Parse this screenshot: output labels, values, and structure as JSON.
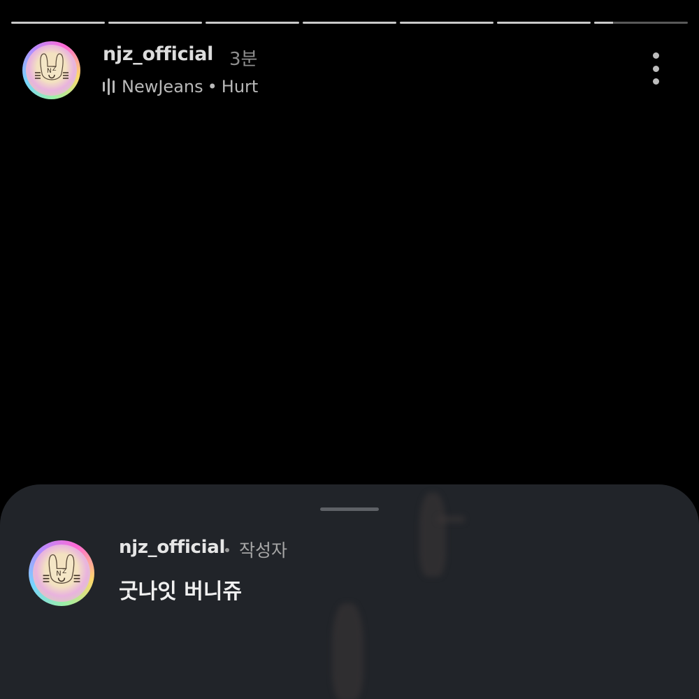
{
  "story": {
    "segments": [
      1,
      1,
      1,
      1,
      1,
      1,
      0.2
    ]
  },
  "header": {
    "username": "njz_official",
    "time_ago": "3분",
    "music": {
      "artist": "NewJeans",
      "separator": "•",
      "track": "Hurt"
    },
    "avatar_logo": "NJZ"
  },
  "comment_sheet": {
    "comment": {
      "username": "njz_official",
      "badge": "작성자",
      "text": "굿나잇 버니쥬"
    }
  },
  "icons": {
    "more": "more-vertical-icon",
    "music": "audio-bars-icon"
  }
}
